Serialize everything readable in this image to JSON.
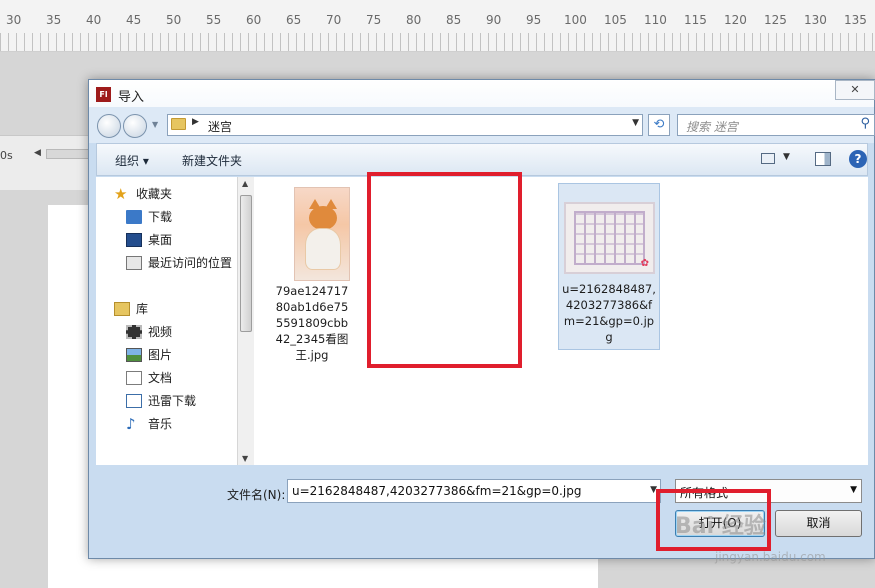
{
  "ruler": {
    "numbers": [
      "30",
      "35",
      "40",
      "45",
      "50",
      "55",
      "60",
      "65",
      "70",
      "75",
      "80",
      "85",
      "90",
      "95",
      "100",
      "105",
      "110",
      "115",
      "120",
      "125",
      "130",
      "135"
    ]
  },
  "timeline": {
    "time_label": "0s"
  },
  "dialog": {
    "app_icon": "Fl",
    "title": "导入",
    "close": "✕",
    "address": {
      "path": "迷宫"
    },
    "search": {
      "placeholder": "搜索 迷宫"
    },
    "toolbar": {
      "organize": "组织 ▾",
      "new_folder": "新建文件夹",
      "help": "?"
    },
    "nav_items": [
      {
        "label": "收藏夹",
        "icon": "star-icon"
      },
      {
        "label": "下载",
        "icon": "download-folder-icon"
      },
      {
        "label": "桌面",
        "icon": "desktop-icon"
      },
      {
        "label": "最近访问的位置",
        "icon": "recent-places-icon"
      },
      {
        "label": "库",
        "icon": "library-icon"
      },
      {
        "label": "视频",
        "icon": "video-icon"
      },
      {
        "label": "图片",
        "icon": "pictures-icon"
      },
      {
        "label": "文档",
        "icon": "documents-icon"
      },
      {
        "label": "迅雷下载",
        "icon": "xunlei-icon"
      },
      {
        "label": "音乐",
        "icon": "music-icon"
      }
    ],
    "files": [
      {
        "name": "79ae12471780ab1d6e755591809cbb42_2345看图王.jpg",
        "thumbnail": "cat-thumbnail"
      },
      {
        "name": "u=2162848487,4203277386&fm=21&gp=0.jpg",
        "thumbnail": "maze-thumbnail",
        "selected": true
      }
    ],
    "filename_label": "文件名(N):",
    "filename_value": "u=2162848487,4203277386&fm=21&gp=0.jpg",
    "file_type": "所有格式",
    "open_button": "打开(O)",
    "cancel_button": "取消"
  },
  "watermark": {
    "brand": "Bai 经验",
    "url": "jingyan.baidu.com"
  },
  "colors": {
    "highlight": "#e01e2d",
    "selection": "#dbe7f4",
    "dialog_frame": "#c9dcf0"
  }
}
